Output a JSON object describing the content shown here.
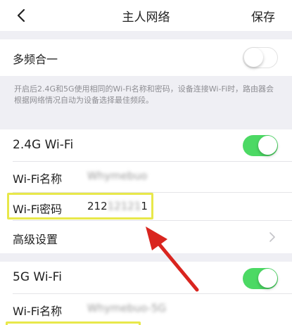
{
  "navbar": {
    "back_icon": "chevron-left-icon",
    "title": "主人网络",
    "save_label": "保存"
  },
  "dual_band": {
    "label": "多频合一",
    "enabled": false,
    "description": "开启后2.4G和5G使用相同的Wi-Fi名称和密码，设备连接Wi-Fi时，路由器会根据网络情况自动为设备选择最佳频段。"
  },
  "wifi_24g": {
    "label": "2.4G Wi-Fi",
    "enabled": true,
    "name_label": "Wi-Fi名称",
    "name_value": "Whymebuo",
    "password_label": "Wi-Fi密码",
    "password_value_visible": "212",
    "password_value_blurred": "12121",
    "password_value_tail": "1"
  },
  "advanced": {
    "label": "高级设置",
    "icon": "chevron-right-icon"
  },
  "wifi_5g": {
    "label": "5G Wi-Fi",
    "enabled": true,
    "name_label": "Wi-Fi名称",
    "name_value": "Whymebuo-5G"
  },
  "colors": {
    "toggle_on": "#4cd964",
    "highlight": "#e8e84a",
    "arrow": "#d9251f",
    "background": "#efeff4"
  }
}
